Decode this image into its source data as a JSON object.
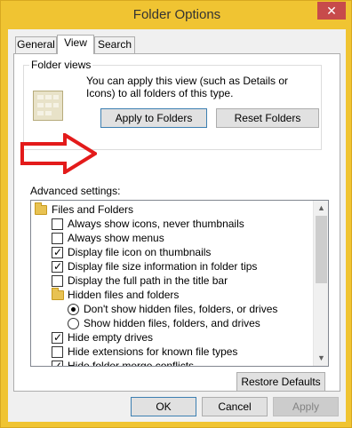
{
  "window": {
    "title": "Folder Options",
    "close_label": "✕"
  },
  "tabs": [
    {
      "label": "General"
    },
    {
      "label": "View"
    },
    {
      "label": "Search"
    }
  ],
  "folder_views": {
    "group_label": "Folder views",
    "description": "You can apply this view (such as Details or Icons) to all folders of this type.",
    "apply_button": "Apply to Folders",
    "reset_button": "Reset Folders"
  },
  "advanced": {
    "label": "Advanced settings:",
    "items": [
      {
        "type": "folder",
        "label": "Files and Folders",
        "indent": 0
      },
      {
        "type": "checkbox",
        "label": "Always show icons, never thumbnails",
        "checked": false,
        "indent": 1
      },
      {
        "type": "checkbox",
        "label": "Always show menus",
        "checked": false,
        "indent": 1
      },
      {
        "type": "checkbox",
        "label": "Display file icon on thumbnails",
        "checked": true,
        "indent": 1
      },
      {
        "type": "checkbox",
        "label": "Display file size information in folder tips",
        "checked": true,
        "indent": 1
      },
      {
        "type": "checkbox",
        "label": "Display the full path in the title bar",
        "checked": false,
        "indent": 1
      },
      {
        "type": "folder",
        "label": "Hidden files and folders",
        "indent": 1
      },
      {
        "type": "radio",
        "label": "Don't show hidden files, folders, or drives",
        "checked": true,
        "indent": 2
      },
      {
        "type": "radio",
        "label": "Show hidden files, folders, and drives",
        "checked": false,
        "indent": 2
      },
      {
        "type": "checkbox",
        "label": "Hide empty drives",
        "checked": true,
        "indent": 1
      },
      {
        "type": "checkbox",
        "label": "Hide extensions for known file types",
        "checked": false,
        "indent": 1
      },
      {
        "type": "checkbox",
        "label": "Hide folder merge conflicts",
        "checked": true,
        "indent": 1
      }
    ],
    "scroll_up": "▲",
    "scroll_down": "▼"
  },
  "restore_button": "Restore Defaults",
  "footer": {
    "ok": "OK",
    "cancel": "Cancel",
    "apply": "Apply"
  }
}
